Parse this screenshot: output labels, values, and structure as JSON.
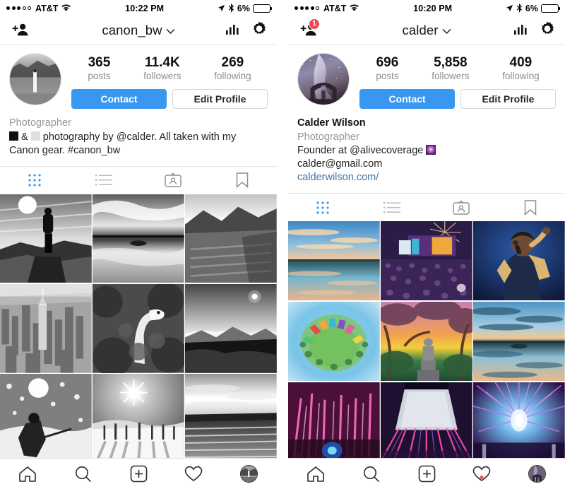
{
  "panels": [
    {
      "id": "canon_bw",
      "status_bar": {
        "signal_dots_filled": 3,
        "signal_dots_total": 5,
        "carrier": "AT&T",
        "wifi_icon": "wifi-icon",
        "time": "10:22 PM",
        "location_icon": "location-arrow-icon",
        "bluetooth_icon": "bluetooth-icon",
        "battery_percent": "6%",
        "battery_fill_color": "#FFCC00"
      },
      "nav": {
        "add_user_icon": "add-user-icon",
        "add_user_badge": "",
        "title": "canon_bw",
        "chevron_icon": "chevron-down-icon",
        "insights_icon": "insights-bars-icon",
        "settings_icon": "gear-icon"
      },
      "profile": {
        "avatar_alt": "profile-avatar",
        "stats": [
          {
            "num": "365",
            "label": "posts"
          },
          {
            "num": "11.4K",
            "label": "followers"
          },
          {
            "num": "269",
            "label": "following"
          }
        ],
        "contact_label": "Contact",
        "edit_profile_label": "Edit Profile",
        "full_name": "",
        "category": "Photographer",
        "bio_line1_prefix": "",
        "bio_line1": "&",
        "bio_line1_rest": "photography by @calder. All taken with my",
        "bio_line2": "Canon gear. #canon_bw",
        "email": "",
        "website": ""
      },
      "tabs": [
        {
          "name": "grid-tab",
          "icon": "grid-icon",
          "active": true
        },
        {
          "name": "list-tab",
          "icon": "list-icon",
          "active": false
        },
        {
          "name": "tagged-photos-tab",
          "icon": "id-card-icon",
          "active": false
        },
        {
          "name": "saved-tab",
          "icon": "bookmark-icon",
          "active": false
        }
      ],
      "grid_caption": "black-and-white photo grid, 9 posts",
      "tabbar": {
        "home_icon": "home-icon",
        "search_icon": "search-icon",
        "add_post_icon": "plus-square-icon",
        "activity_icon": "heart-icon",
        "activity_dot": false,
        "profile_icon": "profile-avatar-icon"
      }
    },
    {
      "id": "calder",
      "status_bar": {
        "signal_dots_filled": 4,
        "signal_dots_total": 5,
        "carrier": "AT&T",
        "wifi_icon": "wifi-icon",
        "time": "10:20 PM",
        "location_icon": "location-arrow-icon",
        "bluetooth_icon": "bluetooth-icon",
        "battery_percent": "6%",
        "battery_fill_color": "#FFCC00"
      },
      "nav": {
        "add_user_icon": "add-user-icon",
        "add_user_badge": "1",
        "title": "calder",
        "chevron_icon": "chevron-down-icon",
        "insights_icon": "insights-bars-icon",
        "settings_icon": "gear-icon"
      },
      "profile": {
        "avatar_alt": "profile-avatar",
        "stats": [
          {
            "num": "696",
            "label": "posts"
          },
          {
            "num": "5,858",
            "label": "followers"
          },
          {
            "num": "409",
            "label": "following"
          }
        ],
        "contact_label": "Contact",
        "edit_profile_label": "Edit Profile",
        "full_name": "Calder Wilson",
        "category": "Photographer",
        "bio_line1": "Founder at @alivecoverage",
        "bio_line2": "",
        "email": "calder@gmail.com",
        "website": "calderwilson.com/"
      },
      "tabs": [
        {
          "name": "grid-tab",
          "icon": "grid-icon",
          "active": true
        },
        {
          "name": "list-tab",
          "icon": "list-icon",
          "active": false
        },
        {
          "name": "tagged-photos-tab",
          "icon": "id-card-icon",
          "active": false
        },
        {
          "name": "saved-tab",
          "icon": "bookmark-icon",
          "active": false
        }
      ],
      "grid_caption": "color photo grid, 9 posts",
      "tabbar": {
        "home_icon": "home-icon",
        "search_icon": "search-icon",
        "add_post_icon": "plus-square-icon",
        "activity_icon": "heart-icon",
        "activity_dot": true,
        "profile_icon": "profile-avatar-icon"
      }
    }
  ],
  "colors": {
    "accent_blue": "#3897F0",
    "link_blue": "#3F73A5",
    "badge_red": "#ED4956",
    "muted_gray": "#8e8e8e",
    "battery_yellow": "#FFCC00"
  }
}
